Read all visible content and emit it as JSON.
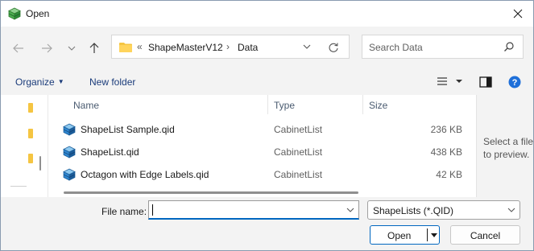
{
  "window": {
    "title": "Open",
    "app_icon": "cabinet-icon"
  },
  "navigation": {
    "back_icon": "arrow-left-icon",
    "forward_icon": "arrow-right-icon",
    "recent_icon": "chevron-down-icon",
    "up_icon": "arrow-up-icon",
    "overflow": "«",
    "breadcrumb": [
      "ShapeMasterV12",
      "Data"
    ],
    "separator": "›",
    "search_placeholder": "Search Data"
  },
  "commandbar": {
    "organize_label": "Organize",
    "new_folder_label": "New folder"
  },
  "filelist": {
    "columns": [
      "Name",
      "Type",
      "Size"
    ],
    "rows": [
      {
        "name": "ShapeList Sample.qid",
        "type": "CabinetList",
        "size": "236 KB"
      },
      {
        "name": "ShapeList.qid",
        "type": "CabinetList",
        "size": "438 KB"
      },
      {
        "name": "Octagon with Edge Labels.qid",
        "type": "CabinetList",
        "size": "42 KB"
      }
    ]
  },
  "preview": {
    "message": "Select a file to preview."
  },
  "footer": {
    "filename_label": "File name:",
    "filename_value": "",
    "filetype_value": "ShapeLists (*.QID)",
    "open_label": "Open",
    "cancel_label": "Cancel"
  },
  "colors": {
    "accent": "#0067c0",
    "folder": "#f5c542",
    "link_text": "#1a3b7a"
  }
}
